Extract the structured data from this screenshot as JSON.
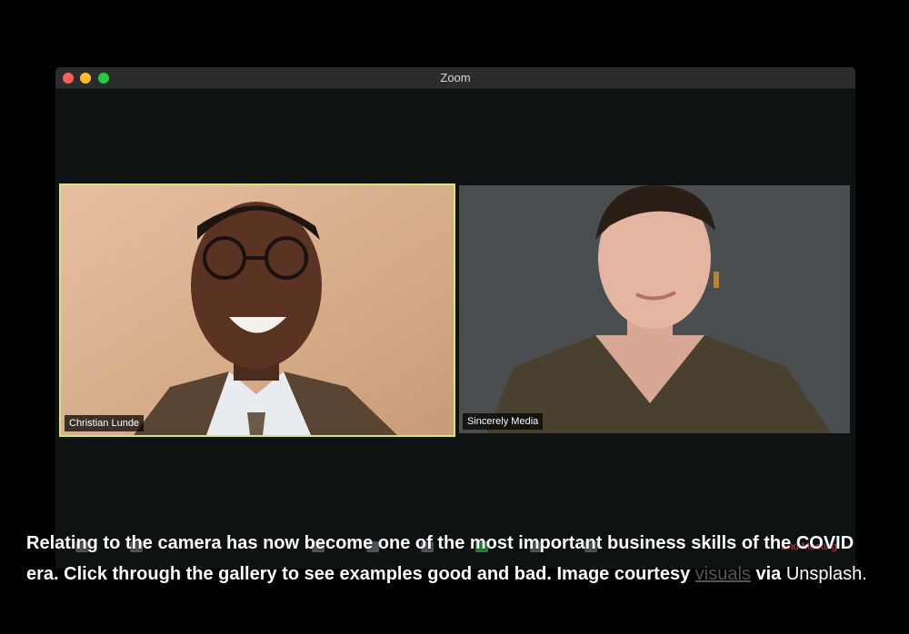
{
  "window": {
    "title": "Zoom",
    "controls": [
      "close",
      "minimize",
      "maximize"
    ]
  },
  "participants": [
    {
      "name": "Christian Lunde",
      "active_speaker": true
    },
    {
      "name": "Sincerely Media",
      "active_speaker": false
    }
  ],
  "toolbar": {
    "icons": [
      "microphone-icon",
      "video-camera-icon",
      "security-icon",
      "participants-icon",
      "chat-icon",
      "share-screen-icon",
      "record-icon",
      "reactions-icon"
    ],
    "end_meeting_label": "End Meeting"
  },
  "caption": {
    "bold_text": "Relating to the camera has now become one of the most important business skills of the COVID era. Click through the gallery to see examples good and bad. Image courtesy",
    "link_text": "visuals",
    "via_text": "via",
    "source_text": "Unsplash."
  },
  "colors": {
    "background": "#000000",
    "window": "#0f1213",
    "active_speaker_border": "#d7e27a",
    "end_meeting": "#e5484d"
  }
}
